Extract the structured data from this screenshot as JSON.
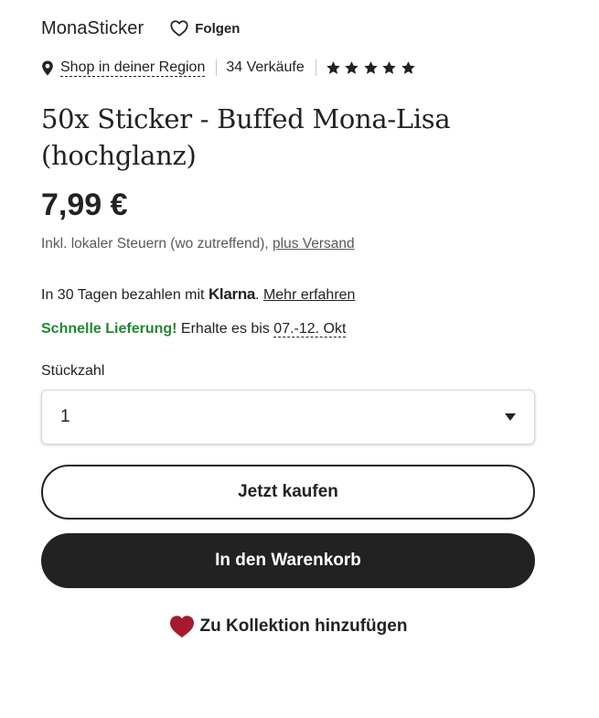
{
  "shop": {
    "name": "MonaSticker",
    "follow_label": "Folgen",
    "region_link": "Shop in deiner Region",
    "sales": "34 Verkäufe",
    "rating_stars": 5
  },
  "product": {
    "title": "50x Sticker - Buffed Mona-Lisa (hochglanz)",
    "price": "7,99 €",
    "tax_prefix": "Inkl. lokaler Steuern (wo zutreffend), ",
    "tax_link": "plus Versand"
  },
  "payment": {
    "prefix": "In 30 Tagen bezahlen mit ",
    "brand": "Klarna",
    "suffix": ". ",
    "link": "Mehr erfahren"
  },
  "delivery": {
    "fast_label": "Schnelle Lieferung!",
    "middle": " Erhalte es bis ",
    "date": "07.-12. Okt"
  },
  "quantity": {
    "label": "Stückzahl",
    "selected": "1"
  },
  "actions": {
    "buy_now": "Jetzt kaufen",
    "add_to_cart": "In den Warenkorb",
    "add_to_collection": "Zu Kollektion hinzufügen"
  },
  "icons": {
    "follow": "heart-outline-icon",
    "location": "location-pin-icon",
    "rating": "star-icon",
    "collection": "heart-filled-icon",
    "dropdown": "caret-down-icon"
  },
  "colors": {
    "text": "#222222",
    "muted": "#595959",
    "fast_delivery": "#258635",
    "cart_button": "#222222",
    "heart": "#a61a2e"
  }
}
